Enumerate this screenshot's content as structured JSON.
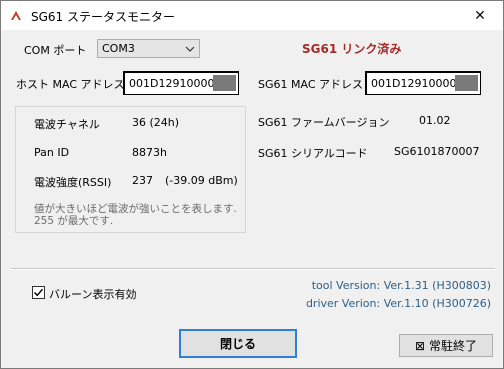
{
  "window": {
    "title": "SG61 ステータスモニター",
    "close_glyph": "✕"
  },
  "connection": {
    "com_port_label": "COM ポート",
    "com_port_value": "COM3",
    "status_text": "SG61 リンク済み"
  },
  "mac": {
    "host_label": "ホスト MAC アドレス",
    "host_value": "001D12910000",
    "sg61_label": "SG61 MAC アドレス",
    "sg61_value": "001D12910000"
  },
  "radio": {
    "channel_label": "電波チャネル",
    "channel_value": "36 (24h)",
    "panid_label": "Pan ID",
    "panid_value": "8873h",
    "rssi_label": "電波強度(RSSI)",
    "rssi_value": "237",
    "rssi_dbm": "(-39.09 dBm)",
    "hint_line1": "値が大きいほど電波が強いことを表します.",
    "hint_line2": "255 が最大です."
  },
  "device": {
    "firmware_label": "SG61 ファームバージョン",
    "firmware_value": "01.02",
    "serial_label": "SG61 シリアルコード",
    "serial_value": "SG6101870007"
  },
  "options": {
    "balloon_label": "バルーン表示有効",
    "balloon_checked": true
  },
  "versions": {
    "tool": "tool Version: Ver.1.31 (H300803)",
    "driver": "driver Verion: Ver.1.10 (H300726)"
  },
  "buttons": {
    "close_label": "閉じる",
    "quit_label": "常駐終了"
  },
  "colors": {
    "status_ok": "#a52a2a",
    "version_text": "#2d5f85",
    "default_button_border": "#2f7ed8"
  }
}
